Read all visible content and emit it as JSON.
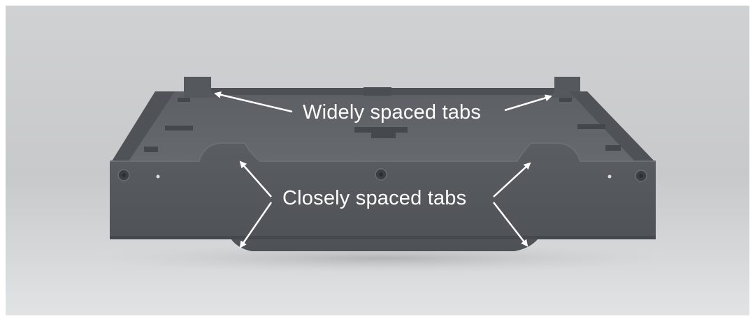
{
  "annotations": {
    "widely_spaced_label": "Widely spaced tabs",
    "closely_spaced_label": "Closely spaced tabs"
  },
  "colors": {
    "backdrop": "#cfd0d2",
    "tray_front": "#54585c",
    "tray_top": "#5f6367",
    "annotation": "#ffffff"
  }
}
